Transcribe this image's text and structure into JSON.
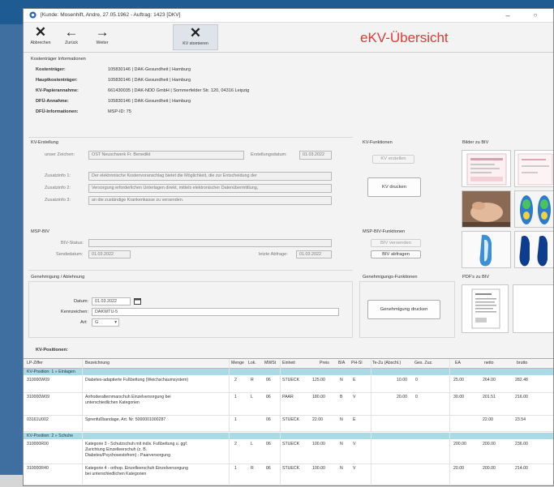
{
  "window": {
    "title": "[Kunde: Mosenhift, Andre, 27.05.1962 - Auftrag: 1423 [DKV]",
    "minimize": "–",
    "close": "✕"
  },
  "toolbar": {
    "buttons": [
      {
        "label": "Abbrechen",
        "glyph": "✕"
      },
      {
        "label": "Zurück",
        "glyph": "←"
      },
      {
        "label": "Weiter",
        "glyph": "→"
      },
      {
        "label": "KV stornieren",
        "glyph": "✕"
      }
    ]
  },
  "header_title": "eKV-Übersicht",
  "kt_info": {
    "section": "Kostenträger Informationen",
    "rows": [
      {
        "label": "Kostenträger:",
        "value": "105830146 | DAK-Gesundheit | Hamburg"
      },
      {
        "label": "Hauptkostenträger:",
        "value": "105830146 | DAK-Gesundheit | Hamburg"
      },
      {
        "label": "KV-Papierannahme:",
        "value": "661430035 | DAK-NDD GmbH | Sommerfelder Str. 120, 04316 Leipzig"
      },
      {
        "label": "DFÜ-Annahme:",
        "value": "105830146 | DAK-Gesundheit | Hamburg"
      },
      {
        "label": "DFÜ-Informationen:",
        "value": "MSP-ID: 75"
      }
    ]
  },
  "kv_erstellung": {
    "section": "KV-Erstellung",
    "unser_zeichen_label": "unser Zeichen:",
    "unser_zeichen_value": "OST Neuschwerk Fr. Benedikt",
    "datum_label": "Erstellungsdatum:",
    "datum_value": "01.03.2022",
    "zusatz": [
      {
        "label": "Zusatzinfo 1:",
        "value": "Der elektronische Kostenvoranschlag bietet die Möglichkeit, die zur Entscheidung der"
      },
      {
        "label": "Zusatzinfo 2:",
        "value": "Versorgung erforderlichen Unterlagen direkt, mittels elektronischer Datenübermittlung,"
      },
      {
        "label": "Zusatzinfo 3:",
        "value": "an die zuständige Krankenkasse zu versenden."
      }
    ]
  },
  "kv_funktionen": {
    "section": "KV-Funktionen",
    "erstellen": "KV erstellen",
    "drucken": "KV drucken"
  },
  "bilder": {
    "section": "Bilder zu BIV"
  },
  "msp": {
    "section": "MSP-BIV",
    "status_label": "BIV-Status:",
    "status_value": "",
    "sende_label": "Sendedatum:",
    "sende_value": "01.03.2022",
    "abfrage_label": "letzte Abfrage:",
    "abfrage_value": "01.03.2022"
  },
  "msp_funktionen": {
    "section": "MSP-BIV-Funktionen",
    "versenden": "BIV versenden",
    "abfragen": "BIV abfragen"
  },
  "genehmigung": {
    "section": "Genehmigung / Ablehnung",
    "datum_label": "Datum:",
    "datum_value": "01.03.2022",
    "zeichen_label": "Kennzeichen:",
    "zeichen_value": "DAKWTU-5",
    "art_label": "Art:",
    "art_value": "G"
  },
  "gen_funktionen": {
    "section": "Genehmigungs-Funktionen",
    "drucken": "Genehmigung drucken"
  },
  "pdfs": {
    "section": "PDF's zu BIV"
  },
  "positionen": {
    "section": "KV-Positionen:",
    "headers": [
      "LP-Ziffer",
      "Bezeichnung",
      "Menge",
      "Lok.",
      "MWSt",
      "Einheit",
      "Preis",
      "B/A",
      "PH-Sl",
      "Te-Zu (Abschl.)",
      "Ges. Zuz.",
      "EA",
      "netto",
      "brutto"
    ],
    "groups": [
      {
        "label": "KV-Position: 1 » Einlagen",
        "rows": [
          {
            "code": "310000W09",
            "desc": "Diabetes-adaptierte Fußbettung (Weichschaumsystem)",
            "menge": "2",
            "lok": "R",
            "mwst": "06",
            "einheit": "STUECK",
            "preis": "125.00",
            "ba": "N",
            "phsl": "E",
            "tezu": "10.00",
            "gzuz": "0",
            "ea": "25.00",
            "netto": "264.00",
            "brutto": "282.48"
          },
          {
            "code": "310000W09",
            "desc": "Anfroderalternmarschuh Einzelversorgung bei unterschiedlichen Kategorien",
            "menge": "1",
            "lok": "L",
            "mwst": "06",
            "einheit": "PAAR",
            "preis": "180.00",
            "ba": "B",
            "phsl": "V",
            "tezu": "20.00",
            "gzuz": "0",
            "ea": "30.00",
            "netto": "201.51",
            "brutto": "216.00"
          },
          {
            "code": "03161U002",
            "desc": "Sprenfußbandage, Art. Nr. 5000001000287",
            "menge": "1",
            "lok": "",
            "mwst": "06",
            "einheit": "STUECK",
            "preis": "22.00",
            "ba": "N",
            "phsl": "E",
            "tezu": "",
            "gzuz": "",
            "ea": "",
            "netto": "22.00",
            "brutto": "23.54"
          }
        ]
      },
      {
        "label": "KV-Position: 2 » Schuhe",
        "rows": [
          {
            "code": "310000R00",
            "desc": "Kategorie 3 - Schutzschuh mit indiv. Fußbettung u. ggf. Zurichtung Einzelleerschuh (z. B. Diabetes/Psychosestofrom) - Paarversorgung",
            "menge": "2",
            "lok": "L",
            "mwst": "06",
            "einheit": "STUECK",
            "preis": "100.00",
            "ba": "N",
            "phsl": "V",
            "tezu": "",
            "gzuz": "",
            "ea": "200.00",
            "netto": "200.00",
            "brutto": "236.00"
          },
          {
            "code": "310000R40",
            "desc": "Kategorie 4 - orthop. Einzelleerschuh Einzelversorgung bei unterschiedlichen Kategorien",
            "menge": "1",
            "lok": "R",
            "mwst": "06",
            "einheit": "STUECK",
            "preis": "100.00",
            "ba": "N",
            "phsl": "V",
            "tezu": "",
            "gzuz": "",
            "ea": "20.00",
            "netto": "200.00",
            "brutto": "214.00"
          }
        ]
      }
    ]
  },
  "colors": {
    "accent_title": "#e23a34",
    "group_row": "#a9dbe6"
  }
}
